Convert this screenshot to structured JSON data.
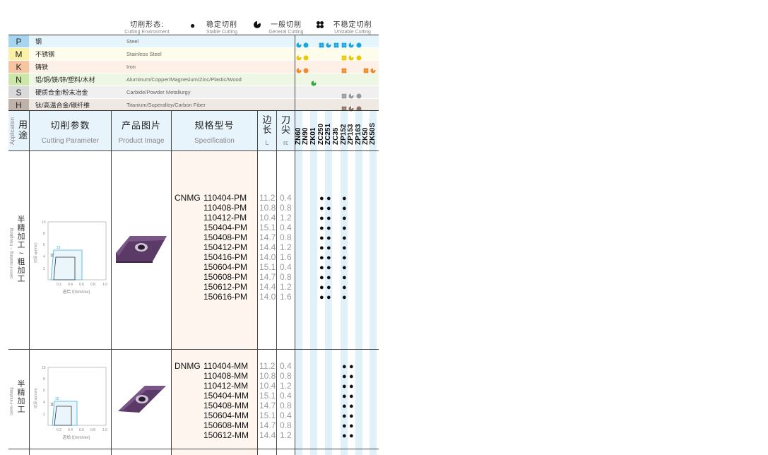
{
  "legend": {
    "title_cn": "切削形态:",
    "title_en": "Cutting Environment",
    "stable_cn": "稳定切削",
    "stable_en": "Stable Cutting",
    "general_cn": "一般切削",
    "general_en": "General Cutting",
    "unstable_cn": "不稳定切削",
    "unstable_en": "Unstable Cutting"
  },
  "colors": {
    "P": "#a6d6ef",
    "M": "#fbf1a6",
    "K": "#f7c5a2",
    "N": "#cde7a9",
    "S": "#d9d9d9",
    "H": "#bfb3a9",
    "P_row": "#e6f4fb",
    "M_row": "#fefcea",
    "K_row": "#fdf0e6",
    "N_row": "#eef6e4",
    "S_row": "#f0f0f0",
    "H_row": "#efe9e4",
    "grade_stripe": "#e0f1fa",
    "spec_bg": "#fdf5ee"
  },
  "materials": [
    {
      "code": "P",
      "cn": "钢",
      "en": "Steel"
    },
    {
      "code": "M",
      "cn": "不锈钢",
      "en": "Stainless Steel"
    },
    {
      "code": "K",
      "cn": "铸铁",
      "en": "Iron"
    },
    {
      "code": "N",
      "cn": "铝/铜/镁/锌/塑料/木材",
      "en": "Aluminum/Copper/Magnesium/Zinc/Plastic/Wood"
    },
    {
      "code": "S",
      "cn": "硬质合金/粉末冶金",
      "en": "Carbide/Powder Metallurgy"
    },
    {
      "code": "H",
      "cn": "钛/高温合金/碳纤维",
      "en": "Titanium/Superalloy/Carbon Fiber"
    }
  ],
  "header": {
    "app_cn": "用途",
    "app_en": "Application",
    "param_cn": "切削参数",
    "param_en": "Cutting Parameter",
    "image_cn": "产品图片",
    "image_en": "Product Image",
    "spec_cn": "规格型号",
    "spec_en": "Specification",
    "L_cn": "边长",
    "L_en": "L",
    "r_cn": "刀尖",
    "r_en": "rε"
  },
  "grades": [
    "ZN60",
    "ZN90",
    "ZK01",
    "ZC250",
    "ZC251",
    "ZC35",
    "ZP152",
    "ZP153",
    "ZP163",
    "ZK50",
    "ZK50S"
  ],
  "section1": {
    "label_cn": "半精加工~粗加工",
    "label_en": "Semi-Finishing ~ Roughing",
    "graph_y_label": "切深 ap(mm)",
    "graph_x_label": "进给 f(mm/rev)",
    "graph_label_15": "15",
    "graph_label_11": "11",
    "prefix": "CNMG",
    "rows": [
      {
        "code": "110404-PM",
        "L": "11.2",
        "r": "0.4"
      },
      {
        "code": "110408-PM",
        "L": "10.8",
        "r": "0.8"
      },
      {
        "code": "110412-PM",
        "L": "10.4",
        "r": "1.2"
      },
      {
        "code": "150404-PM",
        "L": "15.1",
        "r": "0.4"
      },
      {
        "code": "150408-PM",
        "L": "14.7",
        "r": "0.8"
      },
      {
        "code": "150412-PM",
        "L": "14.4",
        "r": "1.2"
      },
      {
        "code": "150416-PM",
        "L": "14.0",
        "r": "1.6"
      },
      {
        "code": "150604-PM",
        "L": "15.1",
        "r": "0.4"
      },
      {
        "code": "150608-PM",
        "L": "14.7",
        "r": "0.8"
      },
      {
        "code": "150612-PM",
        "L": "14.4",
        "r": "1.2"
      },
      {
        "code": "150616-PM",
        "L": "14.0",
        "r": "1.6"
      }
    ]
  },
  "section2": {
    "label_cn": "半精加工",
    "label_en": "Semi-Finishing",
    "graph_y_label": "切深 ap(mm)",
    "graph_x_label": "进给 f(mm/rev)",
    "graph_label_15": "15",
    "graph_label_11": "11",
    "prefix": "DNMG",
    "rows": [
      {
        "code": "110404-MM",
        "L": "11.2",
        "r": "0.4"
      },
      {
        "code": "110408-MM",
        "L": "10.8",
        "r": "0.8"
      },
      {
        "code": "110412-MM",
        "L": "10.4",
        "r": "1.2"
      },
      {
        "code": "150404-MM",
        "L": "15.1",
        "r": "0.4"
      },
      {
        "code": "150408-MM",
        "L": "14.7",
        "r": "0.8"
      },
      {
        "code": "150604-MM",
        "L": "15.1",
        "r": "0.4"
      },
      {
        "code": "150608-MM",
        "L": "14.7",
        "r": "0.8"
      },
      {
        "code": "150612-MM",
        "L": "14.4",
        "r": "1.2"
      }
    ]
  },
  "graph_ticks": {
    "y": [
      "10",
      "8",
      "6",
      "4",
      "2"
    ],
    "x": [
      "0.2",
      "0.4",
      "0.6",
      "0.8",
      "1.0"
    ]
  }
}
